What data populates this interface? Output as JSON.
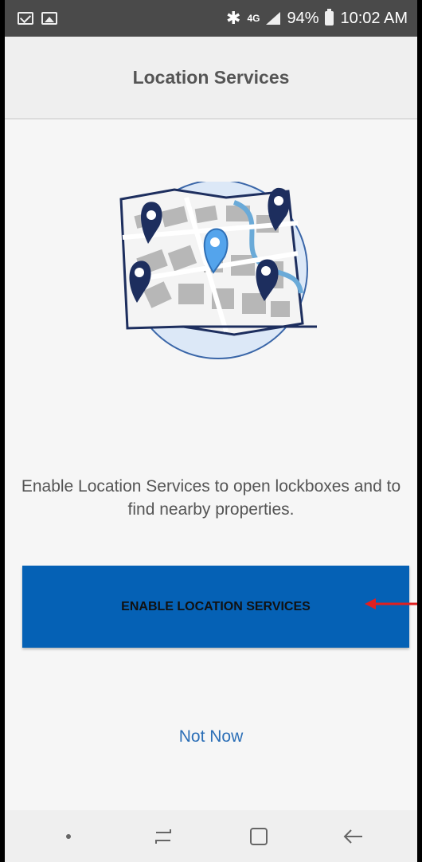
{
  "status_bar": {
    "battery_percent": "94%",
    "time": "10:02 AM",
    "network": "4G",
    "icons": [
      "mail-icon",
      "image-icon",
      "bluetooth-icon",
      "signal-icon",
      "battery-icon"
    ]
  },
  "header": {
    "title": "Location Services"
  },
  "illustration": {
    "icon": "map-with-pins-illustration"
  },
  "message": "Enable Location Services to open lockboxes and to find nearby properties.",
  "enable_button": {
    "label": "ENABLE LOCATION SERVICES",
    "color": "#0561b5"
  },
  "not_now": {
    "label": "Not Now",
    "color": "#2c6fb7"
  },
  "nav_bar": {
    "icons": [
      "dot-icon",
      "recents-icon",
      "home-icon",
      "back-icon"
    ]
  }
}
